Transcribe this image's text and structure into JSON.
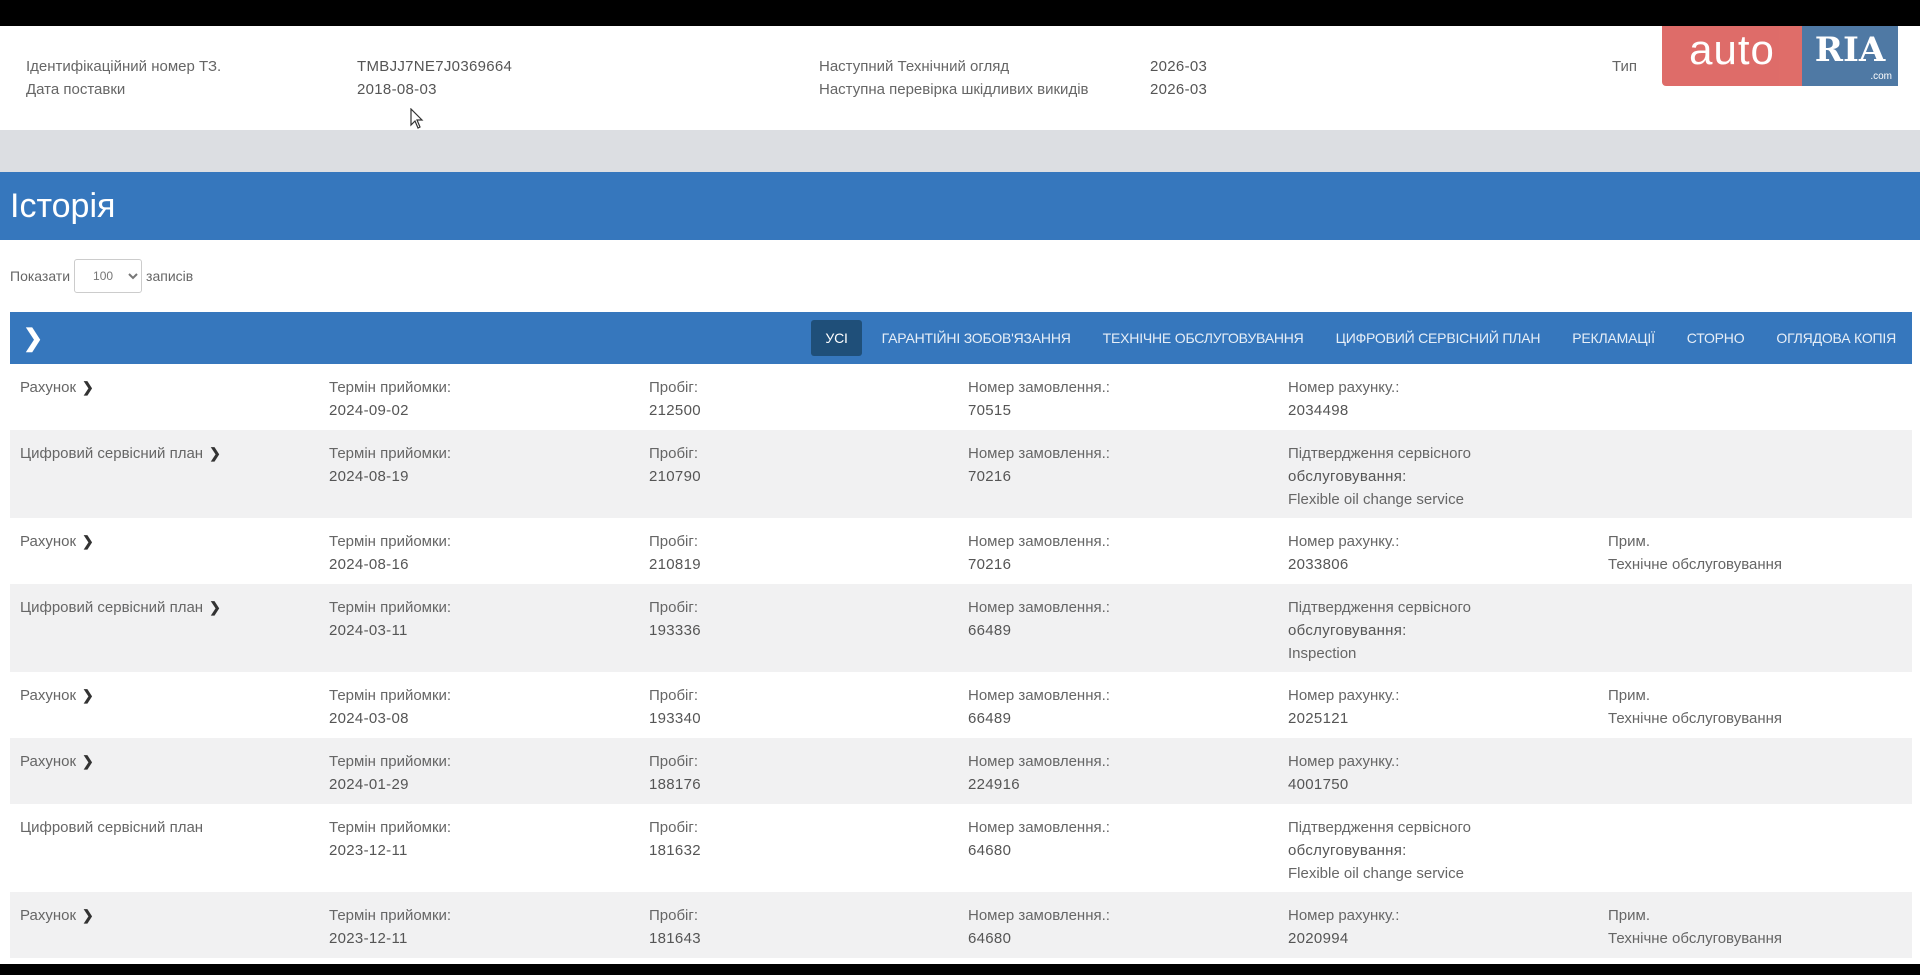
{
  "info": {
    "vin_label": "Ідентифікаційний номер ТЗ.",
    "vin_value": "TMBJJ7NE7J0369664",
    "delivery_label": "Дата поставки",
    "delivery_value": "2018-08-03",
    "next_inspection_label": "Наступний Технічний огляд",
    "next_inspection_value": "2026-03",
    "next_emission_label": "Наступна перевірка шкідливих викидів",
    "next_emission_value": "2026-03",
    "type_label": "Тип"
  },
  "logo": {
    "part1": "auto",
    "part2": "RIA",
    "suffix": ".com"
  },
  "history_title": "Історія",
  "show": {
    "prefix": "Показати",
    "value": "100",
    "suffix": "записів"
  },
  "tabs": [
    {
      "label": "УСІ",
      "active": true
    },
    {
      "label": "ГАРАНТІЙНІ ЗОБОВ'ЯЗАННЯ"
    },
    {
      "label": "ТЕХНІЧНЕ ОБСЛУГОВУВАННЯ"
    },
    {
      "label": "ЦИФРОВИЙ СЕРВІСНИЙ ПЛАН"
    },
    {
      "label": "РЕКЛАМАЦІЇ"
    },
    {
      "label": "СТОРНО"
    },
    {
      "label": "ОГЛЯДОВА КОПІЯ"
    }
  ],
  "rows": [
    {
      "type": "Рахунок",
      "date_label": "Термін прийомки:",
      "date": "2024-09-02",
      "mileage_label": "Пробіг:",
      "mileage": "212500",
      "order_label": "Номер замовлення.:",
      "order": "70515",
      "col5_label": "Номер рахунку.:",
      "col5_value": "2034498",
      "col5_extra": "",
      "note_label": "",
      "note": ""
    },
    {
      "type": "Цифровий сервісний план",
      "date_label": "Термін прийомки:",
      "date": "2024-08-19",
      "mileage_label": "Пробіг:",
      "mileage": "210790",
      "order_label": "Номер замовлення.:",
      "order": "70216",
      "col5_label": "Підтвердження сервісного",
      "col5_value": "обслуговування:",
      "col5_extra": "Flexible oil change service",
      "note_label": "",
      "note": ""
    },
    {
      "type": "Рахунок",
      "date_label": "Термін прийомки:",
      "date": "2024-08-16",
      "mileage_label": "Пробіг:",
      "mileage": "210819",
      "order_label": "Номер замовлення.:",
      "order": "70216",
      "col5_label": "Номер рахунку.:",
      "col5_value": "2033806",
      "col5_extra": "",
      "note_label": "Прим.",
      "note": "Технічне обслуговування"
    },
    {
      "type": "Цифровий сервісний план",
      "date_label": "Термін прийомки:",
      "date": "2024-03-11",
      "mileage_label": "Пробіг:",
      "mileage": "193336",
      "order_label": "Номер замовлення.:",
      "order": "66489",
      "col5_label": "Підтвердження сервісного",
      "col5_value": "обслуговування:",
      "col5_extra": "Inspection",
      "note_label": "",
      "note": ""
    },
    {
      "type": "Рахунок",
      "date_label": "Термін прийомки:",
      "date": "2024-03-08",
      "mileage_label": "Пробіг:",
      "mileage": "193340",
      "order_label": "Номер замовлення.:",
      "order": "66489",
      "col5_label": "Номер рахунку.:",
      "col5_value": "2025121",
      "col5_extra": "",
      "note_label": "Прим.",
      "note": "Технічне обслуговування"
    },
    {
      "type": "Рахунок",
      "date_label": "Термін прийомки:",
      "date": "2024-01-29",
      "mileage_label": "Пробіг:",
      "mileage": "188176",
      "order_label": "Номер замовлення.:",
      "order": "224916",
      "col5_label": "Номер рахунку.:",
      "col5_value": "4001750",
      "col5_extra": "",
      "note_label": "",
      "note": ""
    },
    {
      "type": "Цифровий сервісний план",
      "date_label": "Термін прийомки:",
      "date": "2023-12-11",
      "mileage_label": "Пробіг:",
      "mileage": "181632",
      "order_label": "Номер замовлення.:",
      "order": "64680",
      "col5_label": "Підтвердження сервісного",
      "col5_value": "обслуговування:",
      "col5_extra": "Flexible oil change service",
      "note_label": "",
      "note": ""
    },
    {
      "type": "Рахунок",
      "date_label": "Термін прийомки:",
      "date": "2023-12-11",
      "mileage_label": "Пробіг:",
      "mileage": "181643",
      "order_label": "Номер замовлення.:",
      "order": "64680",
      "col5_label": "Номер рахунку.:",
      "col5_value": "2020994",
      "col5_extra": "",
      "note_label": "Прим.",
      "note": "Технічне обслуговування"
    }
  ]
}
